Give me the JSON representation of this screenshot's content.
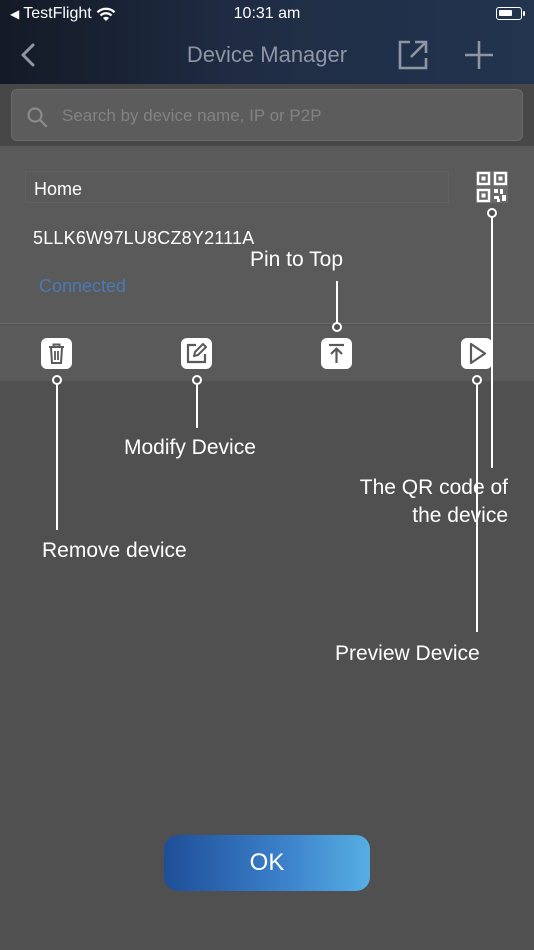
{
  "status_bar": {
    "back_app": "TestFlight",
    "time": "10:31 am"
  },
  "nav": {
    "title": "Device Manager"
  },
  "search": {
    "placeholder": "Search by device name, IP or P2P"
  },
  "device": {
    "name": "Home",
    "serial": "5LLK6W97LU8CZ8Y2111A",
    "status": "Connected"
  },
  "guide": {
    "remove": "Remove device",
    "modify": "Modify Device",
    "pin": "Pin to Top",
    "preview": "Preview Device",
    "qr": "The QR code of\nthe device"
  },
  "ok_label": "OK",
  "colors": {
    "accent": "#4a7ab5",
    "button_start": "#1f4e98",
    "button_end": "#56aee3"
  },
  "icons": {
    "status": [
      "back-arrow-icon",
      "wifi-icon",
      "battery-icon"
    ],
    "nav": [
      "back-icon",
      "share-icon",
      "add-icon"
    ],
    "device": [
      "qr-code-icon"
    ],
    "actions": [
      "trash-icon",
      "edit-icon",
      "pin-top-icon",
      "play-icon"
    ]
  }
}
